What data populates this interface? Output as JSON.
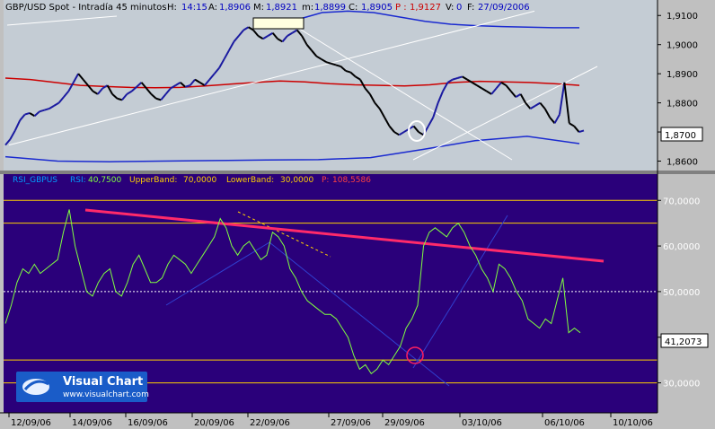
{
  "price_header": {
    "title": "GBP/USD Spot - Intradía 45 minutos",
    "h_label": "H:",
    "h_value": "14:15",
    "a_label": "A:",
    "a_value": "1,8906",
    "m_label": "M:",
    "m_value": "1,8921",
    "min_label": "m:",
    "min_value": "1,8899",
    "c_label": "C:",
    "c_value": "1,8905",
    "p_label": "P :",
    "p_value": "1,9127",
    "v_label": "V:",
    "v_value": "0",
    "date_label": "F:",
    "date_value": "27/09/2006"
  },
  "rsi_header": {
    "name": "RSI_GBPUS",
    "rsi_label": "RSI:",
    "rsi_value": "40,7500",
    "upper_label": "UpperBand:",
    "upper_value": "70,0000",
    "lower_label": "LowerBand:",
    "lower_value": "30,0000",
    "p_label": "P:",
    "p_value": "108,5586"
  },
  "price_axis": {
    "ticks": [
      "1,9100",
      "1,9000",
      "1,8900",
      "1,8800",
      "1,8700",
      "1,8600"
    ],
    "current_label": "1,8700"
  },
  "rsi_axis": {
    "ticks": [
      "70,0000",
      "60,0000",
      "50,0000",
      "40,0000",
      "30,0000"
    ],
    "current_label": "41,2073"
  },
  "x_axis": {
    "ticks": [
      "12/09/06",
      "14/09/06",
      "16/09/06",
      "20/09/06",
      "22/09/06",
      "27/09/06",
      "29/09/06",
      "03/10/06",
      "06/10/06",
      "10/10/06"
    ]
  },
  "logo": {
    "name": "Visual Chart",
    "url": "www.visualchart.com"
  },
  "colors": {
    "price_bg": "#c4ccd4",
    "rsi_bg": "#2a007a",
    "price_up": "#1a1aa0",
    "price_down": "#000000",
    "ma_red": "#cc0000",
    "band_blue": "#1a2ad0",
    "rsi_line": "#80ff40",
    "resistance_pink": "#ff2a6a",
    "level_yellow": "#ffd000",
    "axis_text": "#000000"
  },
  "chart_data": [
    {
      "type": "line",
      "series": [
        {
          "x": [
            0,
            2,
            4,
            6,
            8,
            10,
            12,
            14,
            16,
            18,
            20,
            22,
            24,
            26,
            28,
            30,
            32,
            34,
            36,
            38,
            40,
            42,
            44,
            46,
            48,
            50,
            52,
            54,
            56,
            58,
            60,
            62,
            64,
            66,
            68,
            70,
            72,
            74,
            76,
            78,
            80,
            82,
            84,
            86,
            88,
            90,
            92,
            94,
            96,
            98,
            100,
            102,
            104,
            106,
            108,
            110,
            112,
            114,
            116,
            118,
            120,
            122,
            124,
            126,
            128,
            130,
            132,
            134,
            136,
            138,
            140,
            142,
            144,
            146,
            148,
            150,
            152,
            154,
            156,
            158,
            160,
            162,
            164,
            166,
            168,
            170,
            172,
            174,
            176,
            178,
            180,
            182,
            184,
            186,
            188,
            190,
            192,
            194,
            196,
            198,
            200,
            202,
            204,
            206,
            208,
            210,
            212,
            214,
            216,
            218,
            220,
            222,
            224,
            226,
            228,
            230,
            232,
            234,
            236,
            238
          ],
          "values": [
            1.8655,
            1.8675,
            1.8705,
            1.874,
            1.876,
            1.8765,
            1.8755,
            1.877,
            1.8775,
            1.878,
            1.879,
            1.88,
            1.882,
            1.884,
            1.887,
            1.89,
            1.888,
            1.886,
            1.884,
            1.883,
            1.885,
            1.886,
            1.883,
            1.8815,
            1.881,
            1.883,
            1.884,
            1.8855,
            1.887,
            1.885,
            1.883,
            1.8815,
            1.881,
            1.883,
            1.885,
            1.886,
            1.887,
            1.8855,
            1.886,
            1.888,
            1.887,
            1.886,
            1.888,
            1.89,
            1.892,
            1.895,
            1.898,
            1.901,
            1.903,
            1.905,
            1.906,
            1.905,
            1.903,
            1.902,
            1.903,
            1.904,
            1.902,
            1.901,
            1.903,
            1.904,
            1.905,
            1.903,
            1.9,
            1.898,
            1.896,
            1.895,
            1.894,
            1.8935,
            1.893,
            1.8925,
            1.891,
            1.8905,
            1.889,
            1.888,
            1.885,
            1.883,
            1.88,
            1.878,
            1.875,
            1.872,
            1.87,
            1.869,
            1.87,
            1.871,
            1.872,
            1.87,
            1.869,
            1.872,
            1.875,
            1.88,
            1.884,
            1.887,
            1.888,
            1.8885,
            1.889,
            1.888,
            1.887,
            1.886,
            1.885,
            1.884,
            1.883,
            1.885,
            1.887,
            1.886,
            1.884,
            1.882,
            1.883,
            1.88,
            1.878,
            1.879,
            1.88,
            1.878,
            1.875,
            1.873,
            1.876,
            1.887,
            1.873,
            1.872,
            1.87,
            1.8705
          ]
        }
      ],
      "ma": [
        1.8885,
        1.888,
        1.887,
        1.886,
        1.8856,
        1.8853,
        1.8852,
        1.8853,
        1.8858,
        1.8864,
        1.887,
        1.8875,
        1.8872,
        1.8866,
        1.8862,
        1.886,
        1.8858,
        1.8862,
        1.887,
        1.8874,
        1.8872,
        1.887,
        1.8866,
        1.886
      ],
      "ylim": [
        1.858,
        1.911
      ]
    },
    {
      "type": "line",
      "series": [
        {
          "values": [
            43,
            47,
            52,
            55,
            54,
            56,
            54,
            55,
            56,
            57,
            63,
            68,
            60,
            55,
            50,
            49,
            52,
            54,
            55,
            50,
            49,
            52,
            56,
            58,
            55,
            52,
            52,
            53,
            56,
            58,
            57,
            56,
            54,
            56,
            58,
            60,
            62,
            66,
            64,
            60,
            58,
            60,
            61,
            59,
            57,
            58,
            63,
            62,
            60,
            55,
            53,
            50,
            48,
            47,
            46,
            45,
            45,
            44,
            42,
            40,
            36,
            33,
            34,
            32,
            33,
            35,
            34,
            36,
            38,
            42,
            44,
            47,
            60,
            63,
            64,
            63,
            62,
            64,
            65,
            63,
            60,
            58,
            55,
            53,
            50,
            56,
            55,
            53,
            50,
            48,
            44,
            43,
            42,
            44,
            43,
            48,
            53,
            41,
            42,
            41
          ]
        }
      ],
      "ylim": [
        25,
        73
      ],
      "levels": [
        70,
        65,
        50,
        35,
        30
      ]
    }
  ]
}
